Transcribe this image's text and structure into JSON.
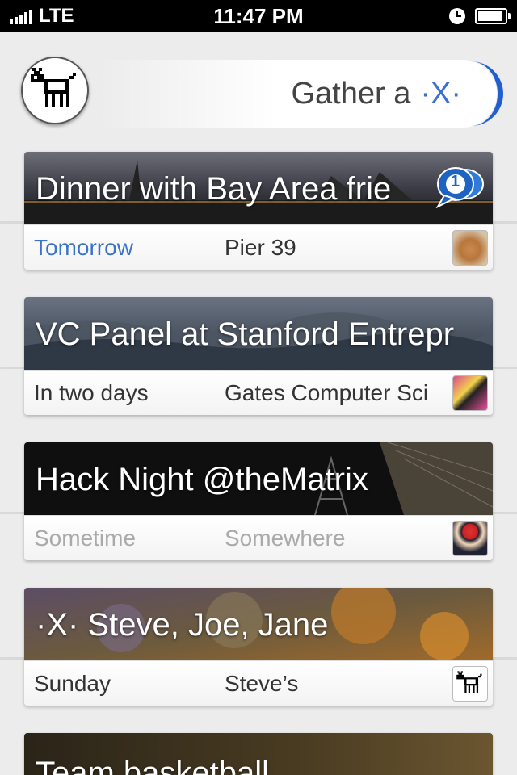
{
  "status_bar": {
    "carrier": "LTE",
    "time": "11:47 PM",
    "battery_percent": 90
  },
  "header": {
    "gather_label": "Gather a",
    "gather_symbol": "·X·",
    "accent_color": "#1f5fd1"
  },
  "events": [
    {
      "title": "Dinner with Bay Area frie",
      "when": "Tomorrow",
      "where": "Pier 39",
      "unread_count": "1",
      "when_color": "blue",
      "thumb_icon": "cat-photo-thumbnail"
    },
    {
      "title": "VC Panel at Stanford Entrepr",
      "when": "In two days",
      "where": "Gates Computer Sci",
      "thumb_icon": "person-sunglasses-thumbnail"
    },
    {
      "title": "Hack Night @theMatrix",
      "when": "Sometime",
      "where": "Somewhere",
      "thumb_icon": "santa-hat-thumbnail"
    },
    {
      "title": "·X· Steve, Joe, Jane",
      "when": "Sunday",
      "where": "Steve’s",
      "thumb_icon": "dog-pixel-thumbnail"
    },
    {
      "title": "Team basketball"
    }
  ]
}
